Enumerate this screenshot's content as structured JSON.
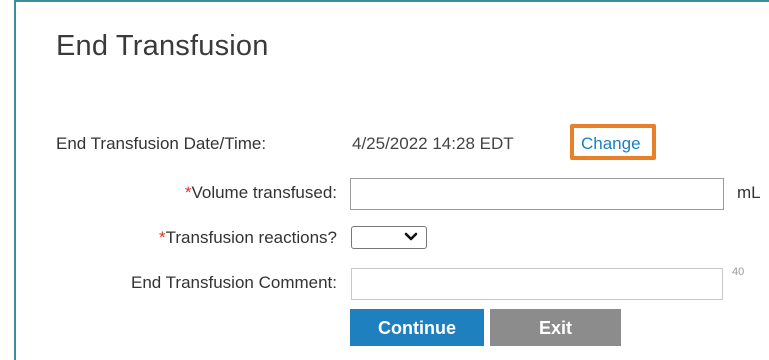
{
  "header": {
    "title": "End Transfusion"
  },
  "form": {
    "end_datetime": {
      "label": "End Transfusion Date/Time:",
      "value": "4/25/2022 14:28 EDT",
      "change_link": "Change"
    },
    "volume": {
      "required_marker": "*",
      "label": "Volume transfused:",
      "value": "",
      "unit": "mL"
    },
    "reactions": {
      "required_marker": "*",
      "label": "Transfusion reactions?",
      "selected": ""
    },
    "comment": {
      "label": "End Transfusion Comment:",
      "value": "",
      "char_limit": "40"
    }
  },
  "actions": {
    "continue_label": "Continue",
    "exit_label": "Exit"
  },
  "colors": {
    "accent": "#1f80c0",
    "highlight": "#e8802a",
    "required": "#e0302a",
    "frame": "#3c8e9a"
  }
}
